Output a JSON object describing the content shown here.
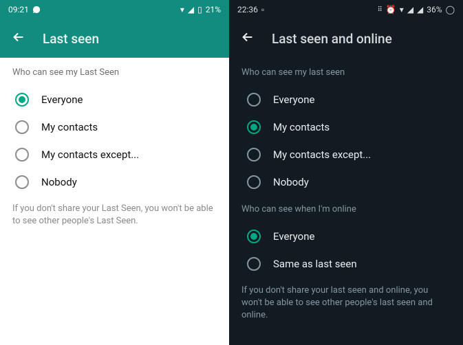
{
  "left": {
    "status": {
      "time": "09:21",
      "battery": "21%"
    },
    "header": {
      "title": "Last seen"
    },
    "section_label": "Who can see my Last Seen",
    "options": {
      "0": {
        "label": "Everyone"
      },
      "1": {
        "label": "My contacts"
      },
      "2": {
        "label": "My contacts except..."
      },
      "3": {
        "label": "Nobody"
      }
    },
    "selected_index": 0,
    "footer": "If you don't share your Last Seen, you won't be able to see other people's Last Seen."
  },
  "right": {
    "status": {
      "time": "22:36",
      "battery": "36%"
    },
    "header": {
      "title": "Last seen and online"
    },
    "section1_label": "Who can see my last seen",
    "section1_options": {
      "0": {
        "label": "Everyone"
      },
      "1": {
        "label": "My contacts"
      },
      "2": {
        "label": "My contacts except..."
      },
      "3": {
        "label": "Nobody"
      }
    },
    "section1_selected_index": 1,
    "section2_label": "Who can see when I'm online",
    "section2_options": {
      "0": {
        "label": "Everyone"
      },
      "1": {
        "label": "Same as last seen"
      }
    },
    "section2_selected_index": 0,
    "footer": "If you don't share your last seen and online, you won't be able to see other people's last seen and online."
  }
}
